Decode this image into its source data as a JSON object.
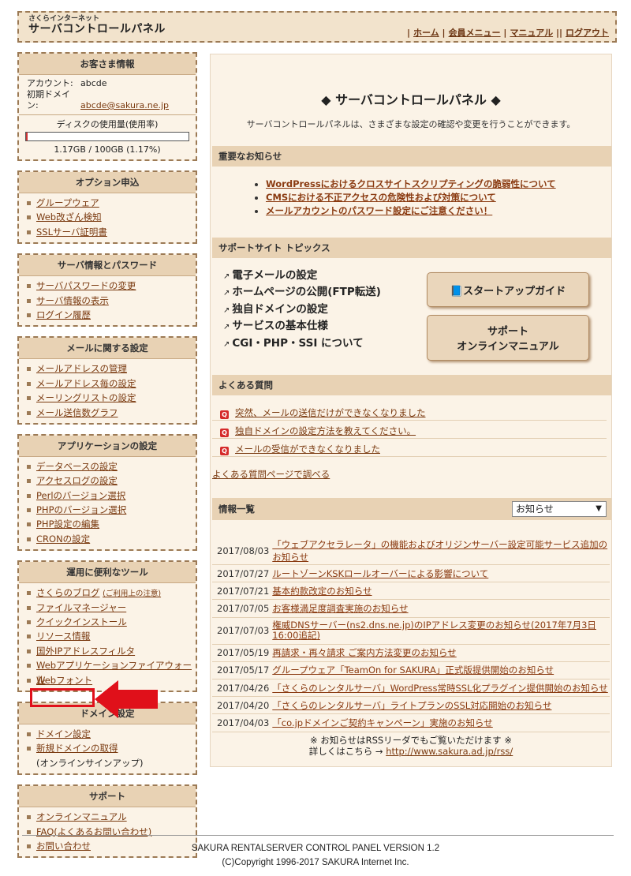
{
  "header": {
    "logo_sub": "さくらインターネット",
    "logo_main": "サーバコントロールパネル",
    "nav": [
      "ホーム",
      "会員メニュー",
      "マニュアル",
      "ログアウト"
    ]
  },
  "sidebar": {
    "customer": {
      "title": "お客さま情報",
      "account_label": "アカウント:",
      "account_value": "abcde",
      "domain_label": "初期ドメイン:",
      "domain_value": "abcde@sakura.ne.jp",
      "disk_label": "ディスクの使用量(使用率)",
      "disk_usage": "1.17GB / 100GB (1.17%)",
      "disk_fraction": 0.0117
    },
    "options": {
      "title": "オプション申込",
      "items": [
        "グループウェア",
        "Web改ざん検知",
        "SSLサーバ証明書"
      ]
    },
    "server_info": {
      "title": "サーバ情報とパスワード",
      "items": [
        "サーバパスワードの変更",
        "サーバ情報の表示",
        "ログイン履歴"
      ]
    },
    "mail": {
      "title": "メールに関する設定",
      "items": [
        "メールアドレスの管理",
        "メールアドレス毎の設定",
        "メーリングリストの設定",
        "メール送信数グラフ"
      ]
    },
    "apps": {
      "title": "アプリケーションの設定",
      "items": [
        "データベースの設定",
        "アクセスログの設定",
        "Perlのバージョン選択",
        "PHPのバージョン選択",
        "PHP設定の編集",
        "CRONの設定"
      ]
    },
    "tools": {
      "title": "運用に便利なツール",
      "blog": "さくらのブログ",
      "blog_note": "(ご利用上の注意)",
      "items": [
        "ファイルマネージャー",
        "クイックインストール",
        "リソース情報",
        "国外IPアドレスフィルタ",
        "Webアプリケーションファイアウォール",
        "Webフォント"
      ]
    },
    "domain": {
      "title": "ドメイン設定",
      "items": [
        "ドメイン設定",
        "新規ドメインの取得"
      ],
      "sub_note": "(オンラインサインアップ)"
    },
    "support": {
      "title": "サポート",
      "items": [
        "オンラインマニュアル",
        "FAQ(よくあるお問い合わせ)",
        "お問い合わせ"
      ]
    }
  },
  "main": {
    "title": "◆ サーバコントロールパネル ◆",
    "description": "サーバコントロールパネルは、さまざまな設定の確認や変更を行うことができます。",
    "notices": {
      "title": "重要なお知らせ",
      "items": [
        "WordPressにおけるクロスサイトスクリプティングの脆弱性について",
        "CMSにおける不正アクセスの危険性および対策について",
        "メールアカウントのパスワード設定にご注意ください！"
      ]
    },
    "topics": {
      "title": "サポートサイト トピックス",
      "items": [
        "電子メールの設定",
        "ホームページの公開(FTP転送)",
        "独自ドメインの設定",
        "サービスの基本仕様",
        "CGI・PHP・SSI について"
      ],
      "startup_button": "スタートアップガイド",
      "manual_button_line1": "サポート",
      "manual_button_line2": "オンラインマニュアル"
    },
    "faq": {
      "title": "よくある質問",
      "items": [
        "突然、メールの送信だけができなくなりました",
        "独自ドメインの設定方法を教えてください。",
        "メールの受信ができなくなりました"
      ],
      "more_link": "よくある質問ページで調べる"
    },
    "news": {
      "title": "情報一覧",
      "select_value": "お知らせ",
      "rows": [
        {
          "date": "2017/08/03",
          "text": "「ウェブアクセラレータ」の機能およびオリジンサーバー設定可能サービス追加のお知らせ"
        },
        {
          "date": "2017/07/27",
          "text": "ルートゾーンKSKロールオーバーによる影響について"
        },
        {
          "date": "2017/07/21",
          "text": "基本約款改定のお知らせ"
        },
        {
          "date": "2017/07/05",
          "text": "お客様満足度調査実施のお知らせ"
        },
        {
          "date": "2017/07/03",
          "text": "権威DNSサーバー(ns2.dns.ne.jp)のIPアドレス変更のお知らせ(2017年7月3日 16:00追記)"
        },
        {
          "date": "2017/05/19",
          "text": "再請求・再々請求 ご案内方法変更のお知らせ"
        },
        {
          "date": "2017/05/17",
          "text": "グループウェア「TeamOn for SAKURA」正式版提供開始のお知らせ"
        },
        {
          "date": "2017/04/26",
          "text": "「さくらのレンタルサーバ」WordPress常時SSL化プラグイン提供開始のお知らせ"
        },
        {
          "date": "2017/04/20",
          "text": "「さくらのレンタルサーバ」ライトプランのSSL対応開始のお知らせ"
        },
        {
          "date": "2017/04/03",
          "text": "「co.jpドメインご契約キャンペーン」実施のお知らせ"
        }
      ],
      "rss_line1": "※ お知らせはRSSリーダでもご覧いただけます ※",
      "rss_line2_prefix": "詳しくはこちら →",
      "rss_url": "http://www.sakura.ad.jp/rss/"
    }
  },
  "footer": {
    "version": "SAKURA RENTALSERVER CONTROL PANEL VERSION 1.2",
    "copyright": "(C)Copyright 1996-2017 SAKURA Internet Inc."
  },
  "colors": {
    "accent_red": "#e0101a",
    "header_bg": "#f2e3cc",
    "section_bg": "#e8d2b4",
    "link": "#7a3a10"
  }
}
